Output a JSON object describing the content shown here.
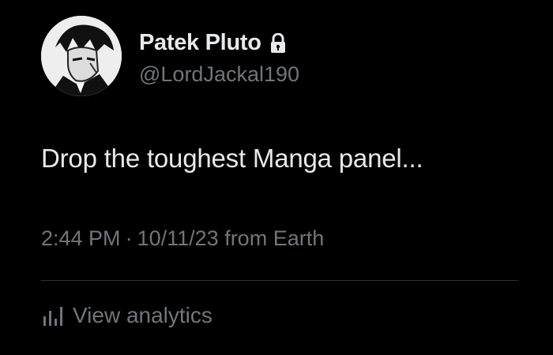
{
  "tweet": {
    "author": {
      "display_name": "Patek Pluto",
      "handle": "@LordJackal190",
      "protected_icon": "lock-icon",
      "avatar": "avatar"
    },
    "text": "Drop the toughest Manga panel...",
    "meta": {
      "time": "2:44 PM",
      "separator": "·",
      "date": "10/11/23",
      "source": "from Earth"
    },
    "analytics": {
      "icon": "bar-chart-icon",
      "label": "View analytics"
    }
  },
  "colors": {
    "background": "#000000",
    "primary_text": "#e7e9ea",
    "secondary_text": "#71767b",
    "divider": "#2f3336"
  }
}
